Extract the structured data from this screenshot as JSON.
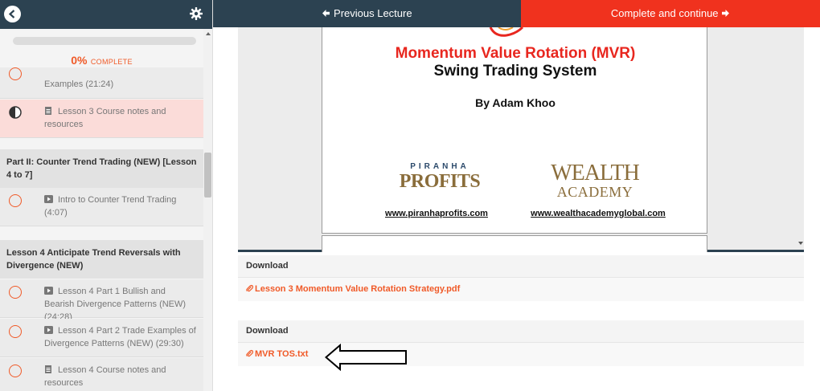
{
  "sidebar": {
    "progress": {
      "percent": "0%",
      "label": "COMPLETE",
      "value": 0
    },
    "items": [
      {
        "label": "Examples (21:24)",
        "type": "video",
        "status": "incomplete"
      },
      {
        "label": "Lesson 3 Course notes and resources",
        "type": "doc",
        "status": "in-progress"
      }
    ],
    "sections": [
      {
        "title": "Part II: Counter Trend Trading (NEW) [Lesson 4 to 7]",
        "items": [
          {
            "label": "Intro to Counter Trend Trading (4:07)",
            "type": "video",
            "status": "incomplete"
          }
        ]
      },
      {
        "title": "Lesson 4 Anticipate Trend Reversals with Divergence (NEW)",
        "items": [
          {
            "label": "Lesson 4 Part 1 Bullish and Bearish Divergence Patterns (NEW) (24:28)",
            "type": "video",
            "status": "incomplete"
          },
          {
            "label": "Lesson 4 Part 2 Trade Examples of Divergence Patterns (NEW) (29:30)",
            "type": "video",
            "status": "incomplete"
          },
          {
            "label": "Lesson 4 Course notes and resources",
            "type": "doc",
            "status": "incomplete"
          }
        ]
      }
    ]
  },
  "topbar": {
    "prev_label": "Previous Lecture",
    "next_label": "Complete and continue"
  },
  "slide": {
    "title": "Momentum Value Rotation (MVR)",
    "subtitle": "Swing Trading System",
    "author": "By Adam Khoo",
    "logo1_top": "PIRANHA",
    "logo1_main": "PROFITS",
    "logo2_line1": "WEALTH",
    "logo2_line2": "ACADEMY",
    "link1": "www.piranhaprofits.com",
    "link2": "www.wealthacademyglobal.com"
  },
  "downloads": [
    {
      "title": "Download",
      "file": "Lesson 3 Momentum Value Rotation Strategy.pdf"
    },
    {
      "title": "Download",
      "file": "MVR TOS.txt"
    }
  ],
  "colors": {
    "nav_dark": "#2c4251",
    "accent_red": "#f0321e",
    "accent_orange": "#f05a28",
    "active_row": "#fbdcd9"
  }
}
